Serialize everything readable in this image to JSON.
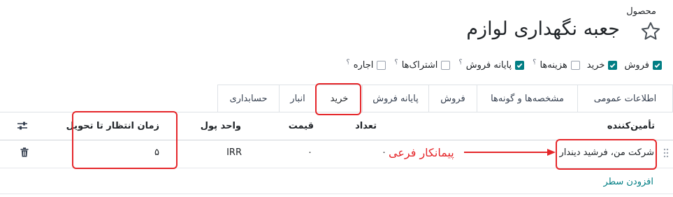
{
  "breadcrumb": "محصول",
  "title": "جعبه نگهداری لوازم",
  "options": [
    {
      "label": "فروش",
      "checked": true,
      "hint": false
    },
    {
      "label": "خرید",
      "checked": true,
      "hint": false
    },
    {
      "label": "هزینه‌ها",
      "checked": false,
      "hint": true
    },
    {
      "label": "پایانه فروش",
      "checked": true,
      "hint": true
    },
    {
      "label": "اشتراک‌ها",
      "checked": false,
      "hint": true
    },
    {
      "label": "اجاره",
      "checked": false,
      "hint": true
    }
  ],
  "hint_mark": "؟",
  "tabs": [
    "اطلاعات عمومی",
    "مشخصه‌ها و گونه‌ها",
    "فروش",
    "پایانه فروش",
    "خرید",
    "انبار",
    "حسابداری"
  ],
  "active_tab": "خرید",
  "table": {
    "headers": {
      "vendor": "تأمین‌کننده",
      "quantity": "تعداد",
      "price": "قیمت",
      "currency": "واحد پول",
      "lead_time": "زمان انتظار تا تحویل"
    },
    "row": {
      "vendor": "شرکت من، فرشید دیندار",
      "quantity": "۰",
      "price": "۰",
      "currency": "IRR",
      "lead_time": "۵"
    },
    "add_line": "افزودن سطر"
  },
  "annotation": "پیمانکار فرعی",
  "colors": {
    "accent": "#017e84",
    "highlight": "#e5262a"
  }
}
